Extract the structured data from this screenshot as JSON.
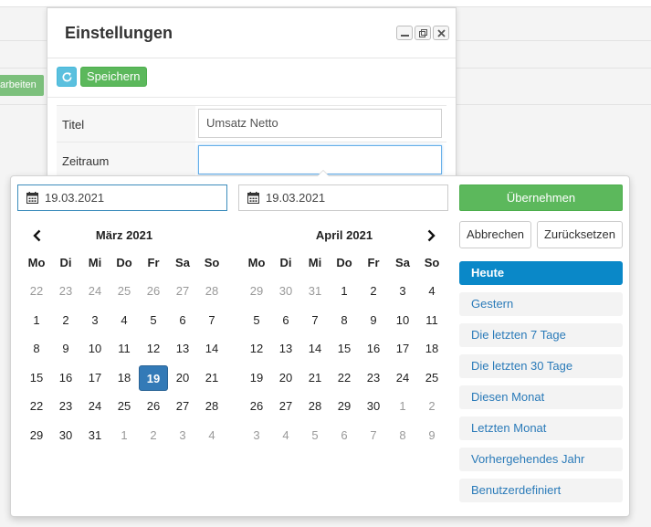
{
  "background": {
    "edit_button_label": "arbeiten"
  },
  "dialog": {
    "title": "Einstellungen",
    "save_label": "Speichern",
    "fields": [
      {
        "label": "Titel",
        "value": "Umsatz Netto"
      },
      {
        "label": "Zeitraum",
        "value": ""
      }
    ]
  },
  "picker": {
    "start_date": "19.03.2021",
    "end_date": "19.03.2021",
    "apply_label": "Übernehmen",
    "cancel_label": "Abbrechen",
    "reset_label": "Zurücksetzen",
    "weekdays": [
      "Mo",
      "Di",
      "Mi",
      "Do",
      "Fr",
      "Sa",
      "So"
    ],
    "left_month": {
      "title": "März 2021",
      "weeks": [
        [
          "22",
          "23",
          "24",
          "25",
          "26",
          "27",
          "28"
        ],
        [
          "1",
          "2",
          "3",
          "4",
          "5",
          "6",
          "7"
        ],
        [
          "8",
          "9",
          "10",
          "11",
          "12",
          "13",
          "14"
        ],
        [
          "15",
          "16",
          "17",
          "18",
          "19",
          "20",
          "21"
        ],
        [
          "22",
          "23",
          "24",
          "25",
          "26",
          "27",
          "28"
        ],
        [
          "29",
          "30",
          "31",
          "1",
          "2",
          "3",
          "4"
        ]
      ]
    },
    "right_month": {
      "title": "April 2021",
      "weeks": [
        [
          "29",
          "30",
          "31",
          "1",
          "2",
          "3",
          "4"
        ],
        [
          "5",
          "6",
          "7",
          "8",
          "9",
          "10",
          "11"
        ],
        [
          "12",
          "13",
          "14",
          "15",
          "16",
          "17",
          "18"
        ],
        [
          "19",
          "20",
          "21",
          "22",
          "23",
          "24",
          "25"
        ],
        [
          "26",
          "27",
          "28",
          "29",
          "30",
          "1",
          "2"
        ],
        [
          "3",
          "4",
          "5",
          "6",
          "7",
          "8",
          "9"
        ]
      ]
    },
    "ranges": [
      "Heute",
      "Gestern",
      "Die letzten 7 Tage",
      "Die letzten 30 Tage",
      "Diesen Monat",
      "Letzten Monat",
      "Vorhergehendes Jahr",
      "Benutzerdefiniert"
    ],
    "active_range": "Heute",
    "colors": {
      "selected_day": "#337ab7",
      "active_range": "#0a88c8",
      "apply_button": "#5cb85c",
      "range_text": "#2b7bb9"
    }
  }
}
